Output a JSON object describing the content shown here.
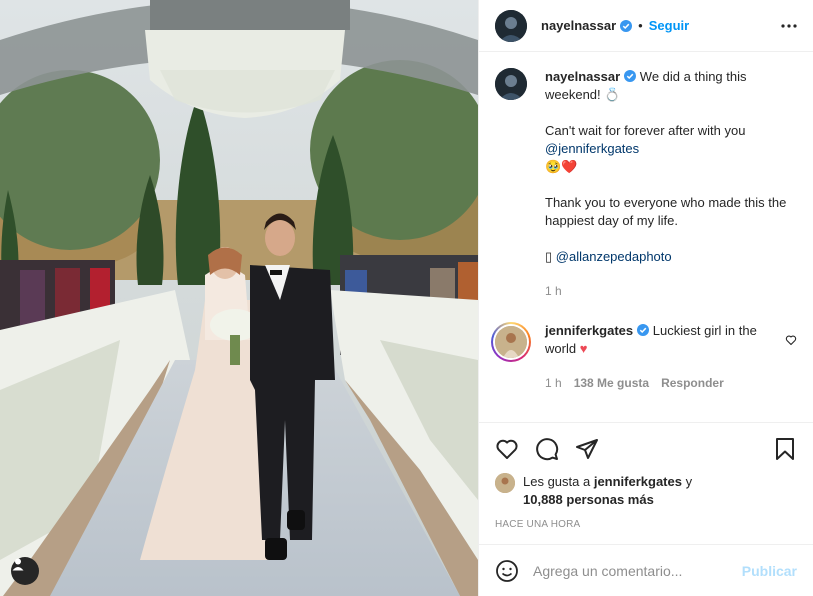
{
  "post": {
    "image_alt": "Wedding couple walking down flower-lined aisle"
  },
  "header": {
    "username": "nayelnassar",
    "dot": "•",
    "follow_label": "Seguir"
  },
  "caption": {
    "username": "nayelnassar",
    "line1": "We did a thing this weekend! 💍",
    "line2": "Can't wait for forever after with you",
    "mention1": "@jenniferkgates",
    "emoji_line": "🥹❤️",
    "line3": "Thank you to everyone who made this the happiest day of my life.",
    "camera_glyph": "▯",
    "mention2": "@allanzepedaphoto",
    "time": "1 h"
  },
  "reply": {
    "username": "jenniferkgates",
    "text": "Luckiest girl in the world",
    "heart": "♥",
    "time": "1 h",
    "likes": "138 Me gusta",
    "reply_label": "Responder"
  },
  "likes": {
    "prefix": "Les gusta a ",
    "user": "jenniferkgates",
    "and": " y",
    "others": "10,888 personas más"
  },
  "timestamp": "HACE UNA HORA",
  "comment_box": {
    "placeholder": "Agrega un comentario...",
    "publish_label": "Publicar"
  },
  "colors": {
    "accent": "#0095f6",
    "mention": "#00376b",
    "muted": "#8e8e8e",
    "heart": "#ed4956"
  }
}
